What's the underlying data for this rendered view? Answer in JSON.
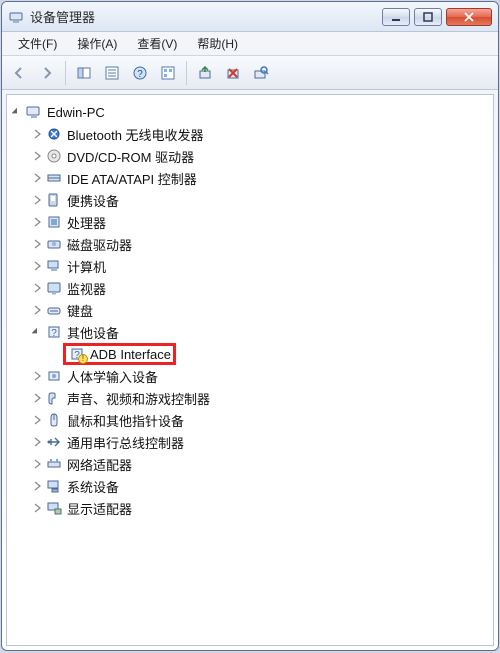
{
  "titlebar": {
    "title": "设备管理器"
  },
  "menubar": {
    "file": "文件(F)",
    "action": "操作(A)",
    "view": "查看(V)",
    "help": "帮助(H)"
  },
  "tree": {
    "root": "Edwin-PC",
    "items": [
      "Bluetooth 无线电收发器",
      "DVD/CD-ROM 驱动器",
      "IDE ATA/ATAPI 控制器",
      "便携设备",
      "处理器",
      "磁盘驱动器",
      "计算机",
      "监视器",
      "键盘",
      "其他设备",
      "人体学输入设备",
      "声音、视频和游戏控制器",
      "鼠标和其他指针设备",
      "通用串行总线控制器",
      "网络适配器",
      "系统设备",
      "显示适配器"
    ],
    "other_child": "ADB Interface"
  }
}
